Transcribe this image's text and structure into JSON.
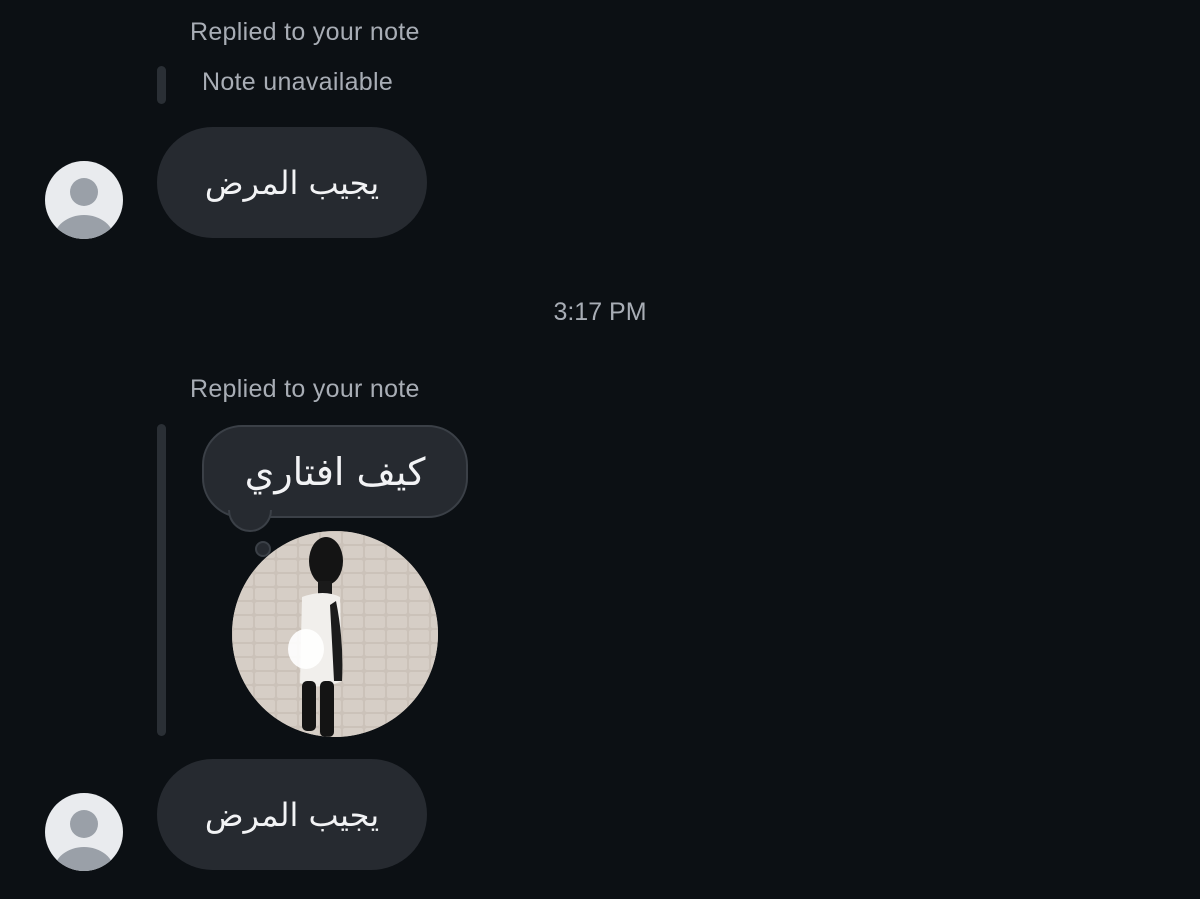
{
  "thread": {
    "top_reply": {
      "label": "Replied to your note",
      "note_text": "Note unavailable",
      "message": "يجيب المرض"
    },
    "timestamp": "3:17 PM",
    "bottom_reply": {
      "label": "Replied to your note",
      "note_text": "كيف افتاري",
      "message": "يجيب المرض"
    }
  },
  "icons": {
    "avatar": "default-profile-icon"
  },
  "colors": {
    "background": "#0c1014",
    "bubble": "#262a30",
    "secondary_text": "#a8adb5",
    "primary_text": "#f2f3f5",
    "avatar_bg": "#e9ebee",
    "avatar_fg": "#9aa0a8"
  }
}
